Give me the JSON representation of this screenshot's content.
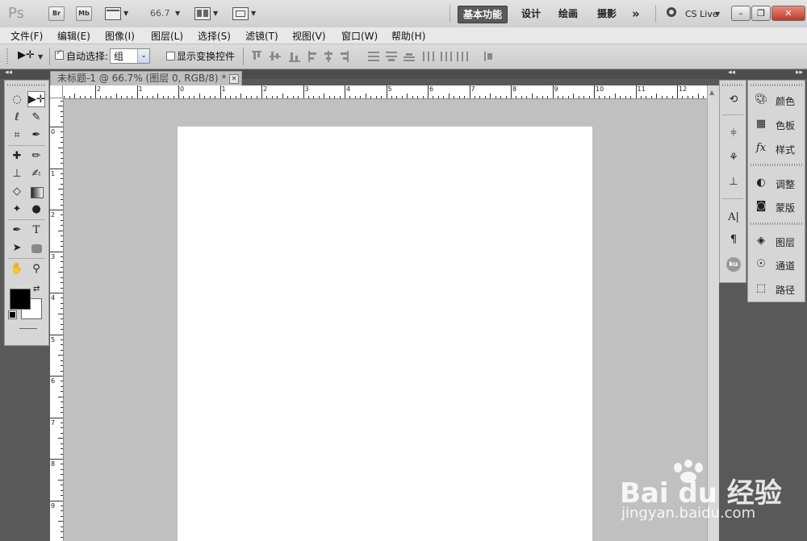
{
  "app": {
    "logo": "Ps",
    "bridge": "Br",
    "minibridge": "Mb",
    "zoom": "66.7",
    "workspaces": [
      "基本功能",
      "设计",
      "绘画",
      "摄影"
    ],
    "more": "»",
    "cslive": "CS Live"
  },
  "menu": [
    "文件(F)",
    "编辑(E)",
    "图像(I)",
    "图层(L)",
    "选择(S)",
    "滤镜(T)",
    "视图(V)",
    "窗口(W)",
    "帮助(H)"
  ],
  "options": {
    "auto_select_label": "自动选择:",
    "auto_select_checked": true,
    "auto_select_value": "组",
    "show_transform_label": "显示变换控件"
  },
  "document": {
    "tab_title": "未标题-1 @ 66.7% (图层 0, RGB/8) *",
    "h_ruler": [
      "2",
      "1",
      "0",
      "1",
      "2",
      "3",
      "4",
      "5",
      "6",
      "7",
      "8",
      "9",
      "10",
      "11",
      "12"
    ],
    "v_ruler": [
      "0",
      "1",
      "2",
      "3",
      "4",
      "5",
      "6",
      "7",
      "8",
      "9"
    ]
  },
  "panels": [
    {
      "label": "颜色",
      "icon": "color-palette-icon"
    },
    {
      "label": "色板",
      "icon": "swatches-grid-icon"
    },
    {
      "label": "样式",
      "icon": "fx-styles-icon"
    },
    {
      "label": "调整",
      "icon": "adjustment-circle-icon"
    },
    {
      "label": "蒙版",
      "icon": "mask-icon"
    },
    {
      "label": "图层",
      "icon": "layers-icon"
    },
    {
      "label": "通道",
      "icon": "channels-icon"
    },
    {
      "label": "路径",
      "icon": "paths-icon"
    }
  ],
  "colors": {
    "foreground": "#000000",
    "background": "#ffffff",
    "active_workspace": "#5a5a5a"
  },
  "watermark": {
    "brand": "Bai du 经验",
    "url": "jingyan.baidu.com"
  }
}
